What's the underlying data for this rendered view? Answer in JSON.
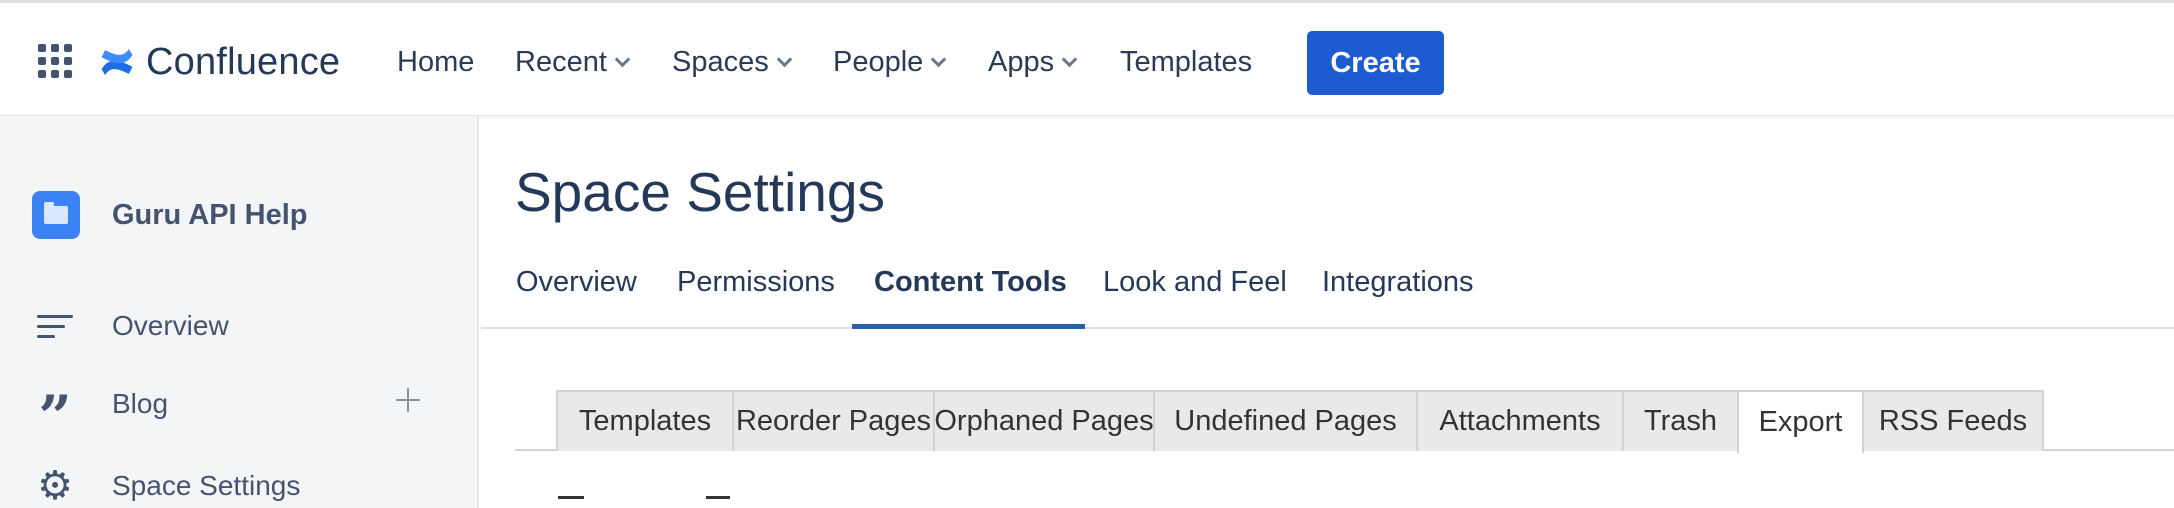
{
  "header": {
    "brand": "Confluence",
    "nav": [
      {
        "label": "Home"
      },
      {
        "label": "Recent"
      },
      {
        "label": "Spaces"
      },
      {
        "label": "People"
      },
      {
        "label": "Apps"
      },
      {
        "label": "Templates"
      }
    ],
    "create_label": "Create",
    "brand_color": "#1f5bd0"
  },
  "sidebar": {
    "space_name": "Guru API Help",
    "items": [
      {
        "label": "Overview",
        "icon": "overview-icon"
      },
      {
        "label": "Blog",
        "icon": "quote-icon"
      },
      {
        "label": "Space Settings",
        "icon": "gear-icon"
      }
    ]
  },
  "main": {
    "title": "Space Settings",
    "tabs": [
      {
        "label": "Overview"
      },
      {
        "label": "Permissions"
      },
      {
        "label": "Content Tools",
        "active": true
      },
      {
        "label": "Look and Feel"
      },
      {
        "label": "Integrations"
      }
    ],
    "subtabs": [
      {
        "label": "Templates"
      },
      {
        "label": "Reorder Pages"
      },
      {
        "label": "Orphaned Pages"
      },
      {
        "label": "Undefined Pages"
      },
      {
        "label": "Attachments"
      },
      {
        "label": "Trash"
      },
      {
        "label": "Export",
        "selected": true
      },
      {
        "label": "RSS Feeds"
      }
    ],
    "active_tab_color": "#2b5fa8"
  }
}
